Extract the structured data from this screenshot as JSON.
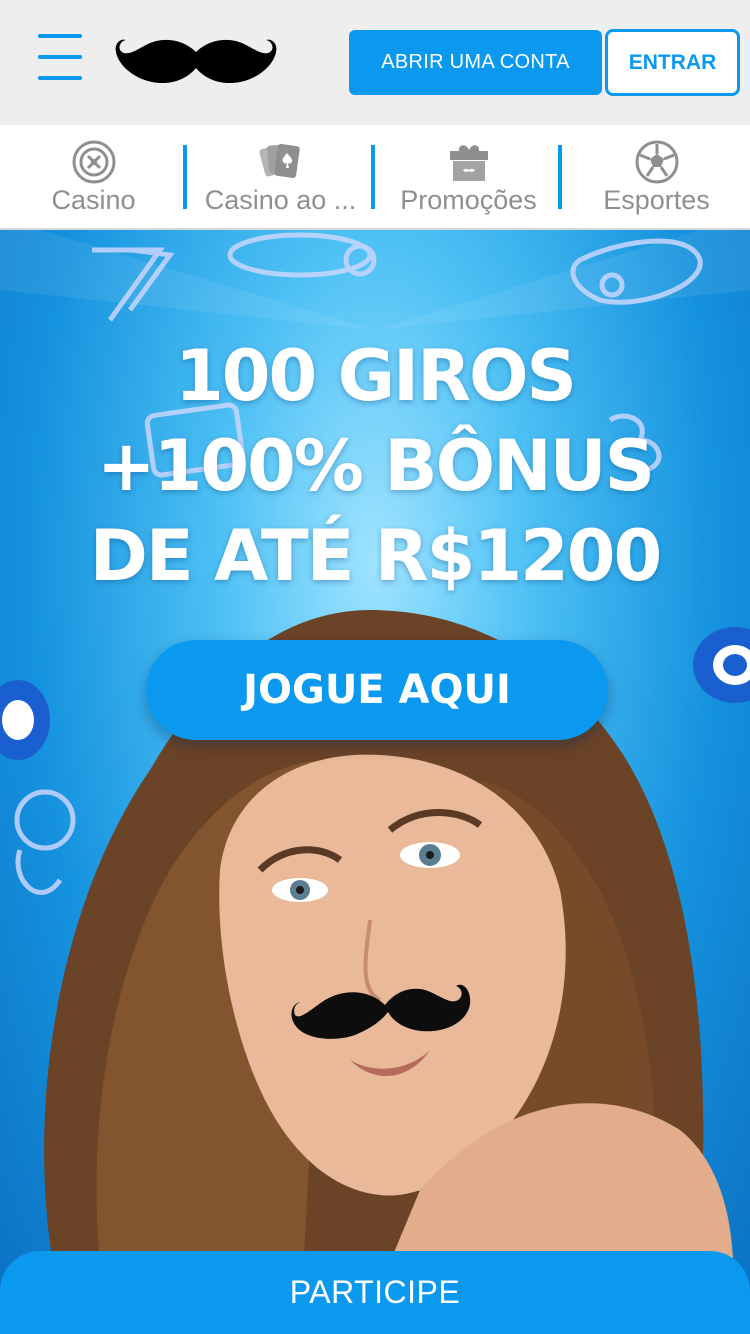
{
  "header": {
    "menu_icon": "hamburger-menu-icon",
    "logo": "mustache-logo",
    "open_account_label": "ABRIR UMA CONTA",
    "login_label": "ENTRAR"
  },
  "nav": {
    "tabs": [
      {
        "label": "Casino",
        "icon": "roulette-icon"
      },
      {
        "label": "Casino ao ...",
        "icon": "playing-cards-icon"
      },
      {
        "label": "Promoções",
        "icon": "gift-icon"
      },
      {
        "label": "Esportes",
        "icon": "soccer-ball-icon"
      }
    ]
  },
  "banner": {
    "line1": "100 GIROS",
    "line2": "+100% BÔNUS",
    "line3": "DE ATÉ R$1200",
    "cta_label": "JOGUE AQUI"
  },
  "footer": {
    "participate_label": "PARTICIPE"
  },
  "colors": {
    "accent": "#0b99ef",
    "header_bg": "#eeeeee",
    "tab_text": "#8f8f8f"
  }
}
